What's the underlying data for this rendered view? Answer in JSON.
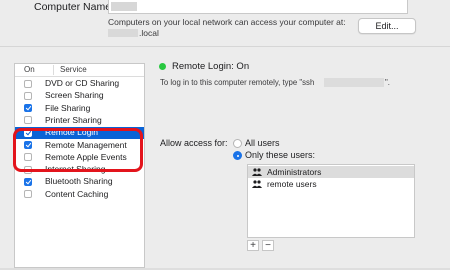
{
  "computer_name": {
    "label": "Computer Name:",
    "network_text": "Computers on your local network can access your computer at:",
    "local_suffix": ".local",
    "edit_button": "Edit..."
  },
  "services": {
    "header_on": "On",
    "header_service": "Service",
    "items": [
      {
        "label": "DVD or CD Sharing",
        "checked": false,
        "selected": false
      },
      {
        "label": "Screen Sharing",
        "checked": false,
        "selected": false
      },
      {
        "label": "File Sharing",
        "checked": true,
        "selected": false
      },
      {
        "label": "Printer Sharing",
        "checked": false,
        "selected": false
      },
      {
        "label": "Remote Login",
        "checked": true,
        "selected": true
      },
      {
        "label": "Remote Management",
        "checked": true,
        "selected": false
      },
      {
        "label": "Remote Apple Events",
        "checked": false,
        "selected": false
      },
      {
        "label": "Internet Sharing",
        "checked": false,
        "selected": false
      },
      {
        "label": "Bluetooth Sharing",
        "checked": true,
        "selected": false
      },
      {
        "label": "Content Caching",
        "checked": false,
        "selected": false
      }
    ]
  },
  "detail": {
    "status": "Remote Login: On",
    "status_color": "#28c840",
    "login_hint": "To log in to this computer remotely, type \"ssh",
    "login_hint_end": "\".",
    "allow_label": "Allow access for:",
    "radio_all": "All users",
    "radio_only": "Only these users:",
    "selected_radio": "only",
    "users": [
      {
        "name": "Administrators",
        "icon": "group-icon",
        "selected": true
      },
      {
        "name": "remote users",
        "icon": "group-icon",
        "selected": false
      }
    ],
    "add_label": "+",
    "remove_label": "−"
  },
  "colors": {
    "selection": "#0a63d6",
    "highlight_outline": "#e3141c",
    "checkbox_on": "#1a73e8"
  }
}
